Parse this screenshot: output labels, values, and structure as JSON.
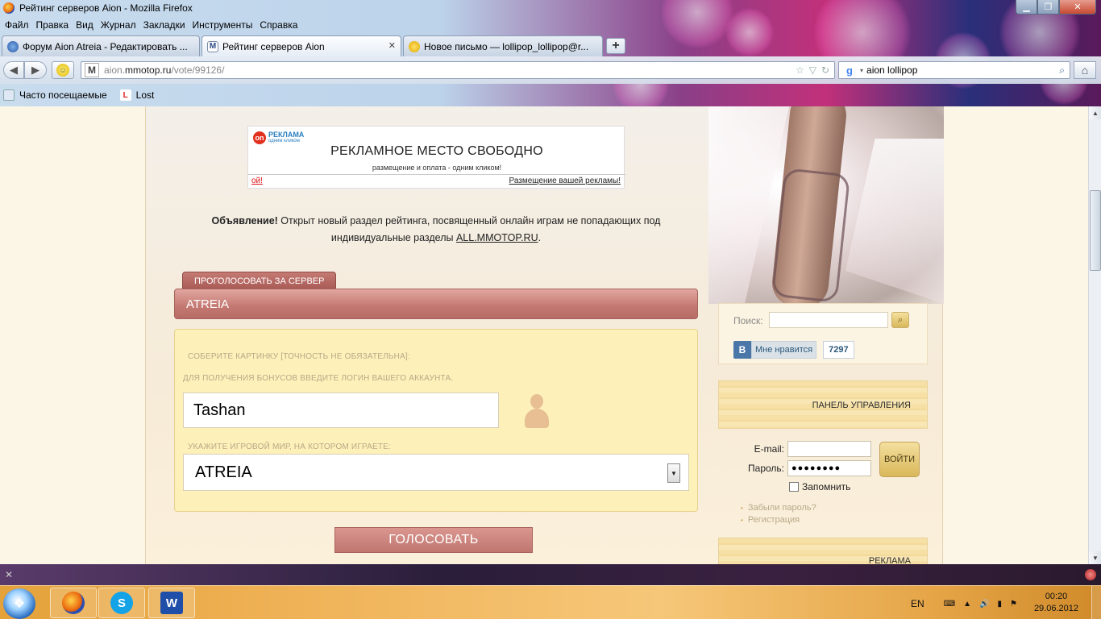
{
  "window": {
    "title": "Рейтинг серверов Aion - Mozilla Firefox"
  },
  "menu": [
    "Файл",
    "Правка",
    "Вид",
    "Журнал",
    "Закладки",
    "Инструменты",
    "Справка"
  ],
  "tabs": [
    {
      "label": "Форум Aion Atreia - Редактировать ...",
      "icon": "forum-favicon-icon",
      "active": false
    },
    {
      "label": "Рейтинг серверов Aion",
      "icon": "mmotop-favicon-icon",
      "active": true
    },
    {
      "label": "Новое письмо — lollipop_lollipop@r...",
      "icon": "mail-favicon-icon",
      "active": false
    }
  ],
  "newtab_label": "+",
  "address": {
    "favicon": "M",
    "prefix": "aion.",
    "host": "mmotop.ru",
    "path": "/vote/99126/"
  },
  "search": {
    "engine": "Google",
    "query": "aion lollipop"
  },
  "bookmarks": [
    {
      "label": "Часто посещаемые",
      "icon": "frequent-icon"
    },
    {
      "label": "Lost",
      "icon": "lost-favicon-icon"
    }
  ],
  "ad": {
    "brand_top": "РЕКЛАМА",
    "brand_bottom": "одним кликом",
    "headline": "РЕКЛАМНОЕ МЕСТО СВОБОДНО",
    "sub": "размещение и оплата - одним кликом!",
    "oops": "ой!",
    "place_link": "Размещение вашей рекламы!"
  },
  "announcement": {
    "lead": "Объявление!",
    "text": " Открыт новый раздел рейтинга, посвященный онлайн играм не попадающих под индивидуальные разделы ",
    "link": "ALL.MMOTOP.RU",
    "end": "."
  },
  "vote": {
    "tab_label": "ПРОГОЛОСОВАТЬ ЗА СЕРВЕР",
    "server_name": "ATREIA",
    "captcha_label": "СОБЕРИТЕ КАРТИНКУ [ТОЧНОСТЬ НЕ ОБЯЗАТЕЛЬНА]:",
    "login_label": "ДЛЯ ПОЛУЧЕНИЯ БОНУСОВ ВВЕДИТЕ ЛОГИН ВАШЕГО АККАУНТА.",
    "login_value": "Tashan",
    "world_label": "УКАЖИТЕ ИГРОВОЙ МИР, НА КОТОРОМ ИГРАЕТЕ:",
    "world_value": "ATREIA",
    "submit_label": "ГОЛОСОВАТЬ"
  },
  "sidebar": {
    "search_label": "Поиск:",
    "vk_letter": "В",
    "vk_like": "Мне нравится",
    "vk_count": "7297",
    "control_panel_title": "ПАНЕЛЬ УПРАВЛЕНИЯ",
    "email_label": "E-mail:",
    "password_label": "Пароль:",
    "password_value": "●●●●●●●●",
    "login_button": "ВОЙТИ",
    "remember_label": "Запомнить",
    "forgot_link": "Забыли пароль?",
    "register_link": "Регистрация",
    "ads_title": "РЕКЛАМА"
  },
  "statusbar": {
    "close": "✕"
  },
  "taskbar": {
    "apps": [
      {
        "name": "firefox-taskbar-button",
        "icon": "firefox-icon"
      },
      {
        "name": "skype-taskbar-button",
        "icon": "skype-icon",
        "glyph": "S"
      },
      {
        "name": "word-taskbar-button",
        "icon": "word-icon",
        "glyph": "W"
      }
    ],
    "lang": "EN",
    "time": "00:20",
    "date": "29.06.2012"
  },
  "colors": {
    "accent_vote": "#c07770",
    "form_bg": "#fdf0b8",
    "vk_blue": "#4a76a8"
  }
}
